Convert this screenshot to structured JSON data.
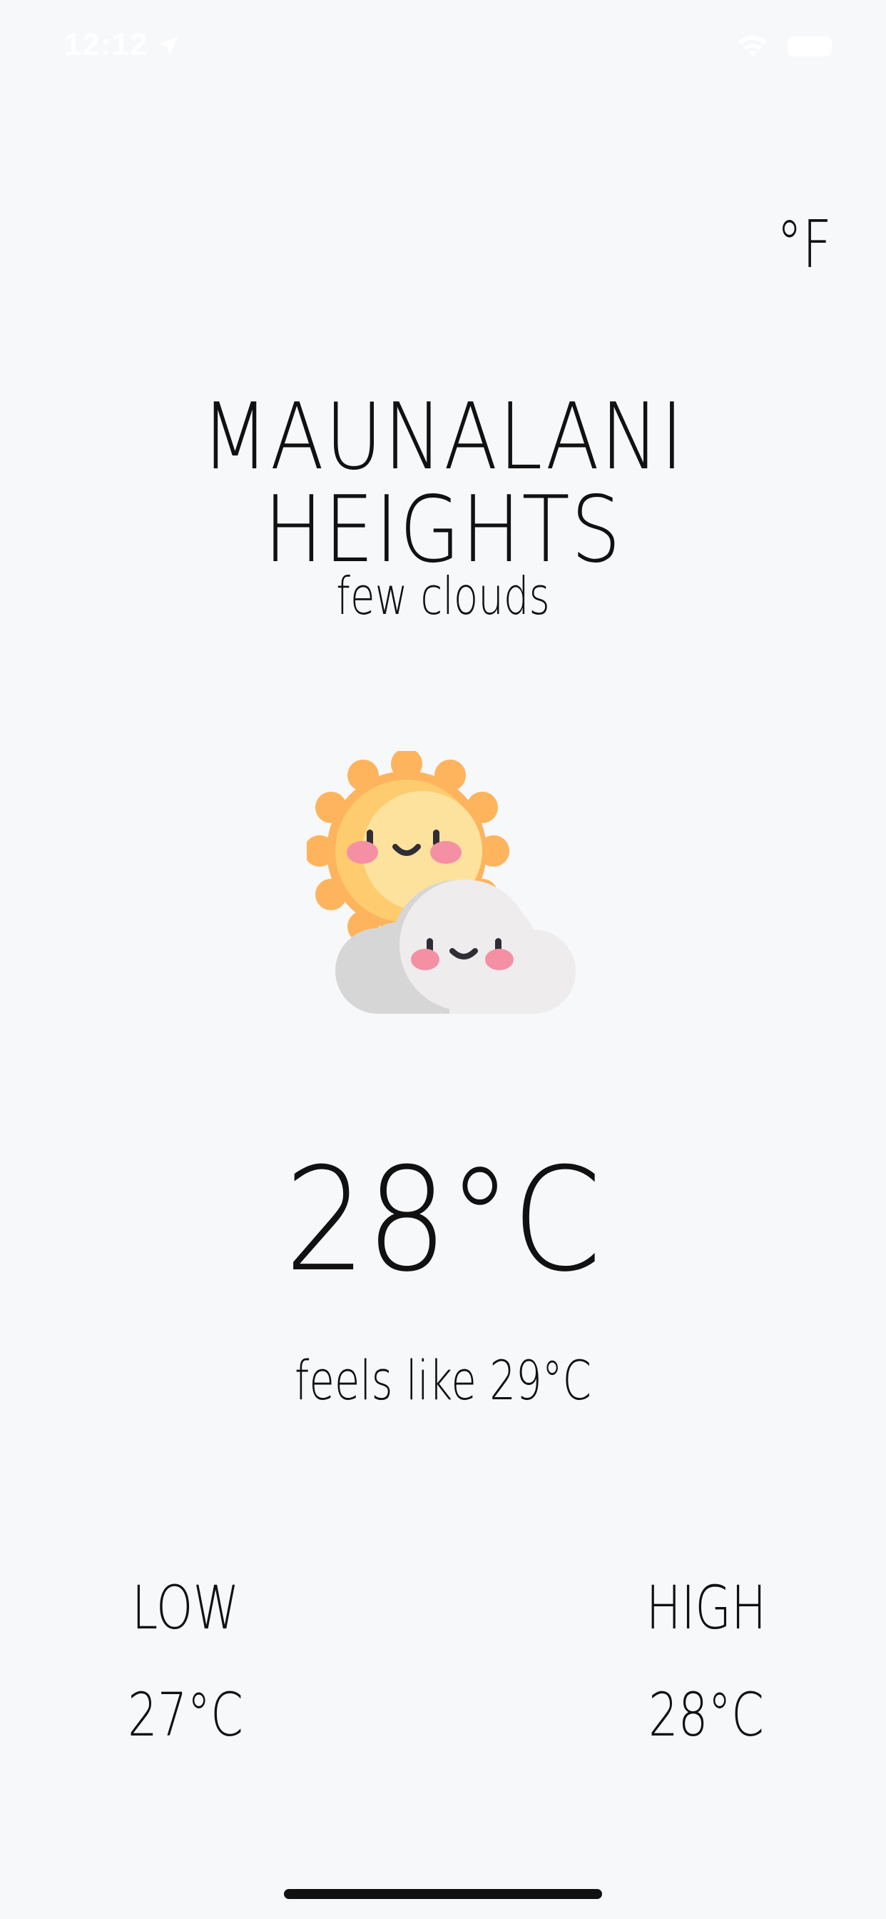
{
  "status_bar": {
    "time": "12:12",
    "icons": [
      "location-arrow-icon",
      "wifi-icon",
      "battery-icon"
    ]
  },
  "unit_toggle": "°F",
  "city": "MAUNALANI HEIGHTS",
  "condition": "few clouds",
  "weather_icon": "sun-behind-cloud-icon",
  "temperature": "28°C",
  "feels_like": "feels like 29°C",
  "low": {
    "label": "LOW",
    "value": "27°C"
  },
  "high": {
    "label": "HIGH",
    "value": "28°C"
  },
  "colors": {
    "background": "#f7f8fa",
    "text": "#111111",
    "sun_outer": "#fdb45c",
    "sun_inner": "#fecb6f",
    "cloud_light": "#eeecec",
    "cloud_dark": "#d6d6d6",
    "cheek": "#f590a4"
  }
}
